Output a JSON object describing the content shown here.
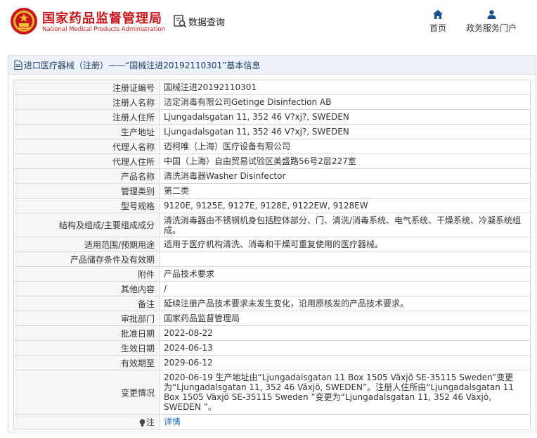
{
  "header": {
    "brand_cn": "国家药品监督管理局",
    "brand_en": "National Medical Products Administration",
    "query_label": "数据查询",
    "nav_home": "首页",
    "nav_portal": "政务服务门户"
  },
  "colors": {
    "brand": "#c8161d",
    "nav_icon": "#1a4f8b",
    "link": "#1d6fbf"
  },
  "panel": {
    "title": "进口医疗器械（注册）——“国械注进20192110301”基本信息"
  },
  "rows": [
    {
      "label": "注册证编号",
      "value": "国械注进20192110301"
    },
    {
      "label": "注册人名称",
      "value": "洁定消毒有限公司Getinge Disinfection AB"
    },
    {
      "label": "注册人住所",
      "value": "Ljungadalsgatan 11, 352 46 V?xj?, SWEDEN"
    },
    {
      "label": "生产地址",
      "value": "Ljungadalsgatan 11, 352 46 V?xj?, SWEDEN"
    },
    {
      "label": "代理人名称",
      "value": "迈柯唯（上海）医疗设备有限公司"
    },
    {
      "label": "代理人住所",
      "value": "中国（上海）自由贸易试验区美盛路56号2层227室"
    },
    {
      "label": "产品名称",
      "value": "清洗消毒器Washer Disinfector"
    },
    {
      "label": "管理类别",
      "value": "第二类"
    },
    {
      "label": "型号规格",
      "value": "9120E, 9125E, 9127E, 9128E, 9122EW, 9128EW"
    },
    {
      "label": "结构及组成/主要组成成分",
      "value": "清洗消毒器由不锈钢机身包括腔体部分、门、清洗/消毒系统、电气系统、干燥系统、冷凝系统组成。"
    },
    {
      "label": "适用范围/预期用途",
      "value": "适用于医疗机构清洗、消毒和干燥可重复使用的医疗器械。"
    },
    {
      "label": "产品储存条件及有效期",
      "value": ""
    },
    {
      "label": "附件",
      "value": "产品技术要求"
    },
    {
      "label": "其他内容",
      "value": "/"
    },
    {
      "label": "备注",
      "value": "延续注册产品技术要求未发生变化，沿用原核发的产品技术要求。"
    },
    {
      "label": "审批部门",
      "value": "国家药品监督管理局"
    },
    {
      "label": "批准日期",
      "value": "2022-08-22"
    },
    {
      "label": "生效日期",
      "value": "2024-06-13"
    },
    {
      "label": "有效期至",
      "value": "2029-06-12"
    },
    {
      "label": "变更情况",
      "value": "2020-06-19 生产地址由“Ljungadalsgatan 11 Box 1505 Växjö SE-35115 Sweden”变更为“Ljungadalsgatan 11, 352 46 Växjö, SWEDEN”。注册人住所由“Ljungadalsgatan 11 Box 1505 Växjö SE-35115 Sweden ”变更为“Ljungadalsgatan 11, 352 46 Växjö, SWEDEN ”。"
    },
    {
      "label": "注",
      "value": "详情"
    }
  ]
}
